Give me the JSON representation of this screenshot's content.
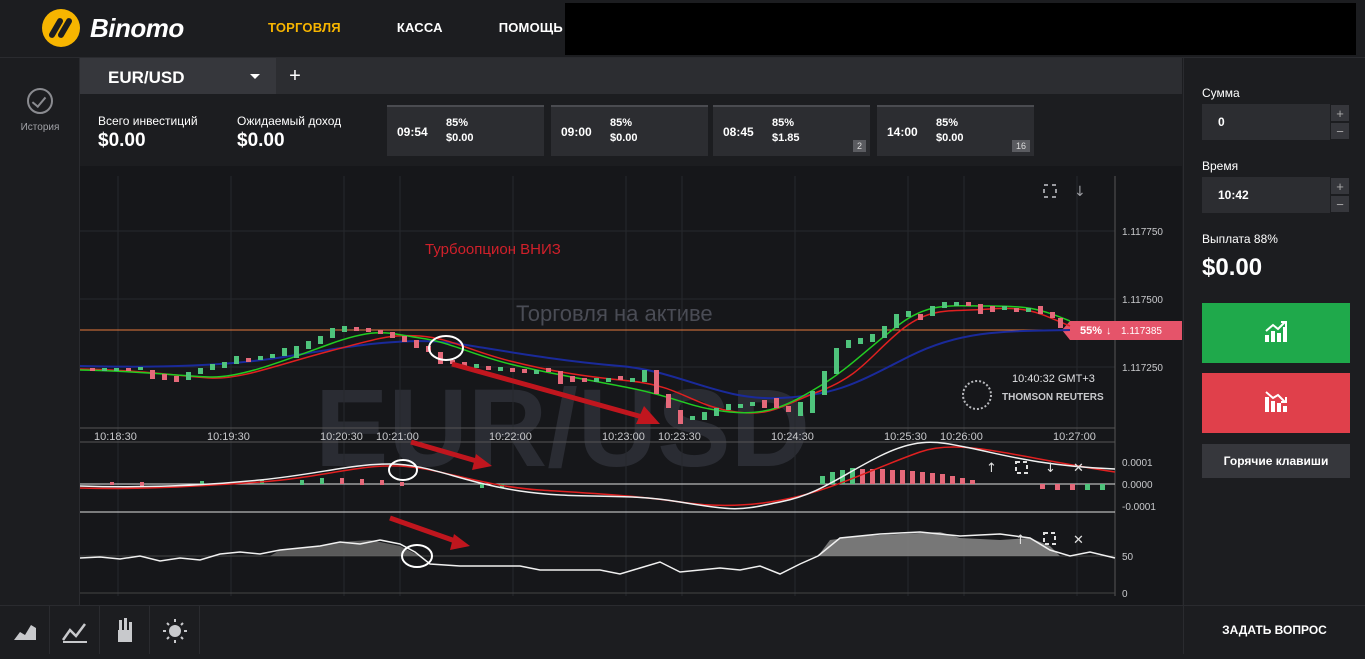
{
  "brand": {
    "name": "Binomo"
  },
  "nav": {
    "trade": "ТОРГОВЛЯ",
    "cashier": "КАССА",
    "help": "ПОМОЩЬ"
  },
  "sidebar": {
    "history": "История"
  },
  "tabs": {
    "asset": "EUR/USD",
    "add": "+"
  },
  "stats": {
    "total_label": "Всего инвестиций",
    "total_value": "$0.00",
    "expected_label": "Ожидаемый доход",
    "expected_value": "$0.00"
  },
  "expirations": [
    {
      "time": "09:54",
      "pct": "85%",
      "amount": "$0.00",
      "badge": ""
    },
    {
      "time": "09:00",
      "pct": "85%",
      "amount": "$0.00",
      "badge": ""
    },
    {
      "time": "08:45",
      "pct": "85%",
      "amount": "$1.85",
      "badge": "2"
    },
    {
      "time": "14:00",
      "pct": "85%",
      "amount": "$0.00",
      "badge": "16"
    }
  ],
  "chart": {
    "annotation": "Турбоопцион ВНИЗ",
    "watermark_top": "Торговля на активе",
    "watermark_asset": "EUR/USD",
    "price_tag_pct": "55%",
    "price_tag_value": "1.117385",
    "server_time": "10:40:32 GMT+3",
    "provider": "THOMSON REUTERS",
    "price_ticks": [
      "1.117750",
      "1.117500",
      "1.117250"
    ],
    "time_ticks": [
      "10:18:30",
      "10:19:30",
      "10:20:30",
      "10:21:00",
      "10:22:00",
      "10:23:00",
      "10:23:30",
      "10:24:30",
      "10:25:30",
      "10:26:00",
      "10:27:00"
    ],
    "macd_ticks": [
      "0.0001",
      "0.0000",
      "-0.0001"
    ],
    "osc_ticks": [
      "50",
      "0"
    ],
    "colors": {
      "up": "#4fc47c",
      "down": "#e5697a",
      "ma_red": "#e02020",
      "ma_green": "#22cc22",
      "ma_blue": "#1a2a9a",
      "arrow": "#c0161e"
    }
  },
  "panel": {
    "amount_label": "Сумма",
    "amount_value": "0",
    "time_label": "Время",
    "time_value": "10:42",
    "payout_label": "Выплата 88%",
    "payout_value": "$0.00",
    "hotkeys": "Горячие клавиши",
    "plus": "+",
    "minus": "−"
  },
  "footer": {
    "ask": "ЗАДАТЬ ВОПРОС"
  }
}
